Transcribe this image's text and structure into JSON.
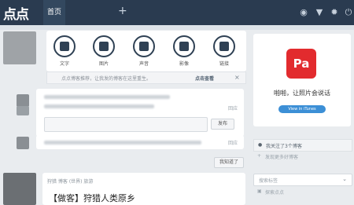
{
  "header": {
    "logo": "点点",
    "tab_home": "首页",
    "add_tab": "+",
    "icons": [
      "eye-icon",
      "shirt-icon",
      "gear-icon",
      "power-icon"
    ]
  },
  "post_types": [
    {
      "label": "文字",
      "icon": "text-icon"
    },
    {
      "label": "图片",
      "icon": "photo-icon"
    },
    {
      "label": "声音",
      "icon": "audio-icon"
    },
    {
      "label": "影像",
      "icon": "video-icon"
    },
    {
      "label": "链接",
      "icon": "link-icon"
    }
  ],
  "notice": {
    "text": "点点博客推荐，让我发的博客在这里重生。",
    "link": "点击查看",
    "close": "×"
  },
  "feed": {
    "reply_label": "回应",
    "publish_label": "发布",
    "know_more_label": "我知道了",
    "post_title": "【做客】狩猎人类原乡",
    "post_tags": "狩猎 博客 (世界) 旅游"
  },
  "sidebar": {
    "ad_logo": "Pa",
    "ad_title": "啪啪，让照片会说话",
    "ad_button": "View in iTunes",
    "following": "我关注了3个博客",
    "discover": "发现更多好博客",
    "search_placeholder": "搜索标签",
    "explore": "探索点点"
  }
}
